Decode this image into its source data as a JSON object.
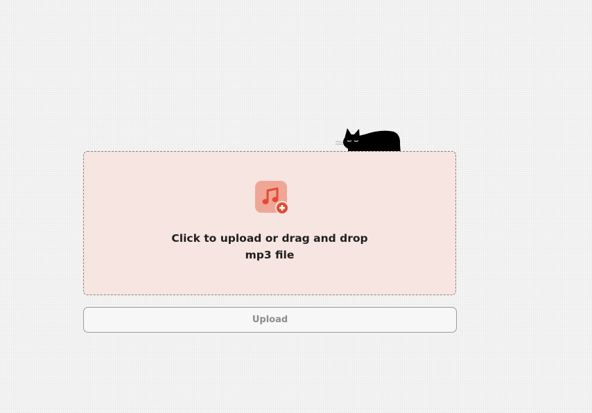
{
  "dropzone": {
    "line1": "Click to upload or drag and drop",
    "line2": "mp3 file",
    "icon": "music-file-add-icon",
    "accent_color": "#e85a45",
    "background_color": "#f6e5e0"
  },
  "upload_button": {
    "label": "Upload",
    "disabled": true
  },
  "decoration": {
    "mascot": "sleeping-cat-icon"
  }
}
